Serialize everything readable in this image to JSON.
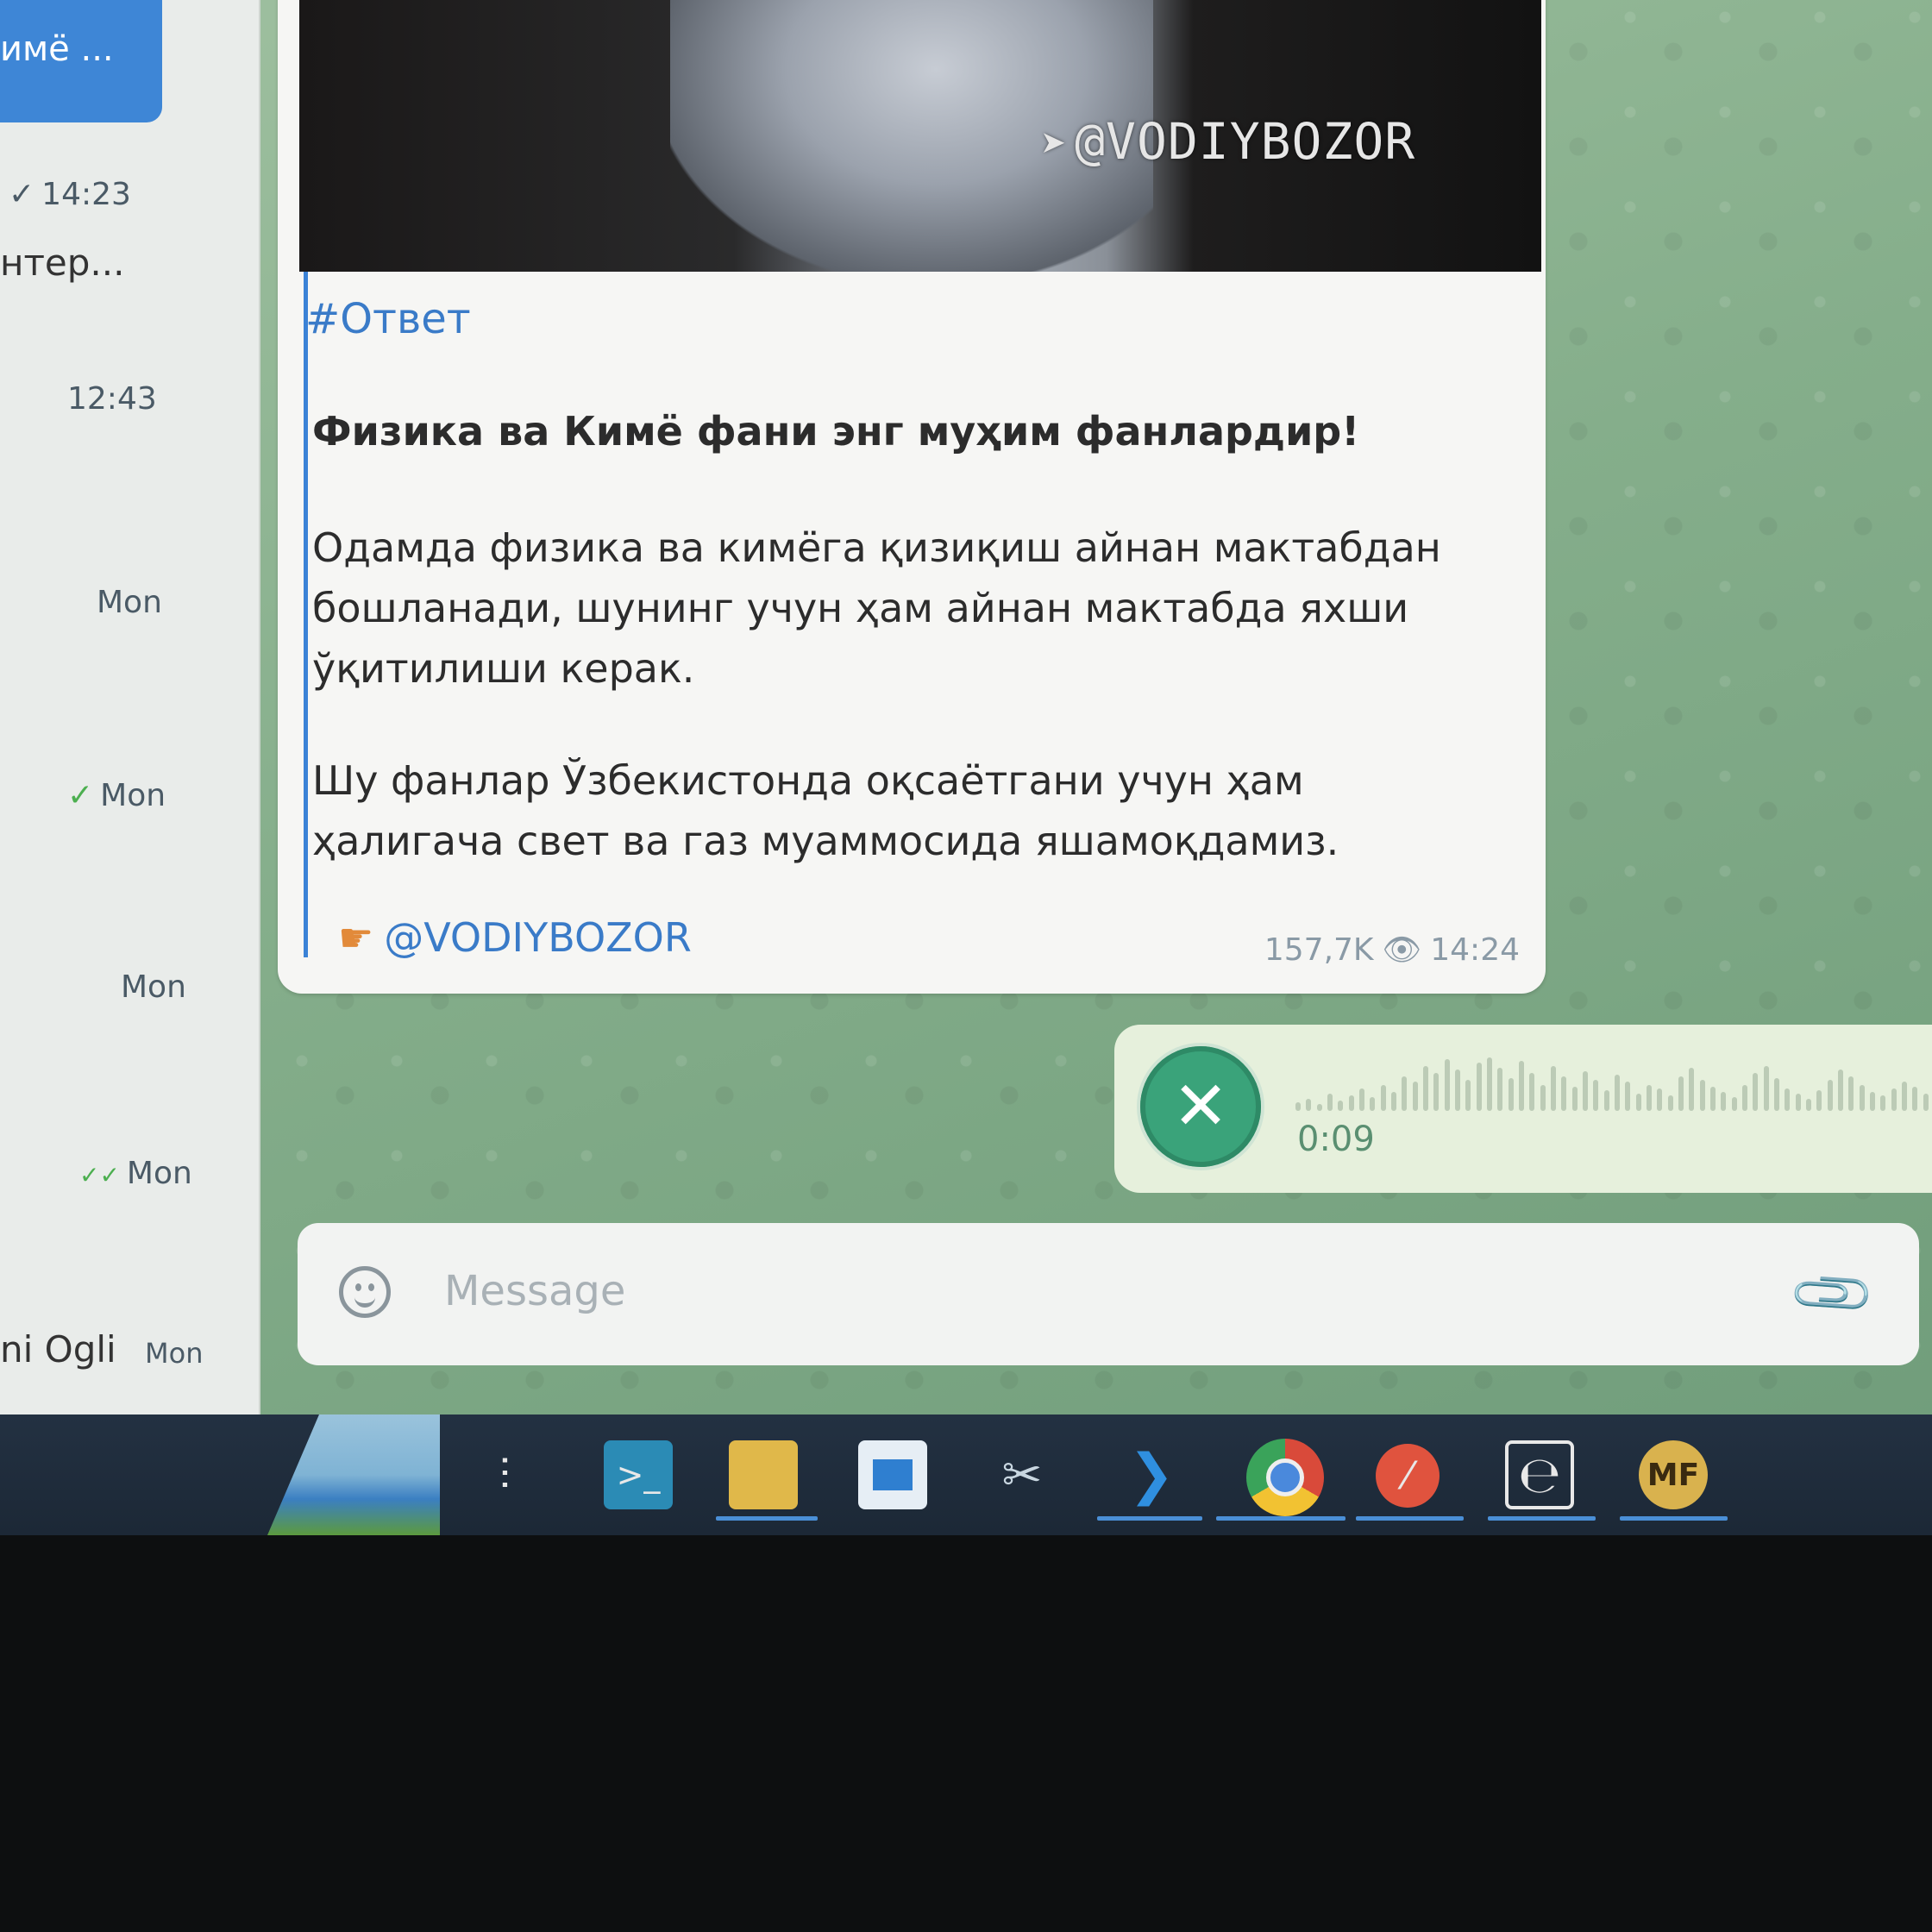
{
  "chat_list": {
    "items": [
      {
        "snippet": "имё ...",
        "active": true
      },
      {
        "time": "14:23",
        "check": "✓"
      },
      {
        "snippet": "нтер..."
      },
      {
        "time": "12:43"
      },
      {
        "time": "Mon"
      },
      {
        "time": "Mon",
        "check": "✓"
      },
      {
        "time": "Mon"
      },
      {
        "time": "Mon",
        "check": "✓✓"
      },
      {
        "snippet": "ni Ogli",
        "time": "Mon"
      }
    ]
  },
  "post": {
    "photo_watermark": "@VODIYBOZOR",
    "hashtag": "#Ответ",
    "headline": "Физика ва Кимё фани энг муҳим фанлардир!",
    "paragraph1": "Одамда физика ва кимёга қизиқиш айнан мактабдан бошланади, шунинг учун ҳам айнан мактабда яхши ўқитилиши керак.",
    "paragraph2": "Шу фанлар Ўзбекистонда оқсаётгани учун ҳам ҳалигача свет ва газ муаммосида яшамоқдамиз.",
    "signature": "@VODIYBOZOR",
    "views": "157,7K",
    "time": "14:24"
  },
  "voice_message": {
    "duration": "0:09"
  },
  "composer": {
    "placeholder": "Message"
  },
  "taskbar": {
    "icons": [
      "task-view-icon",
      "terminal-icon",
      "file-explorer-icon",
      "store-icon",
      "paint-icon",
      "vscode-icon",
      "chrome-icon",
      "red-app-icon",
      "ce-app-icon",
      "mf-app-icon"
    ],
    "mf_label": "MF"
  }
}
